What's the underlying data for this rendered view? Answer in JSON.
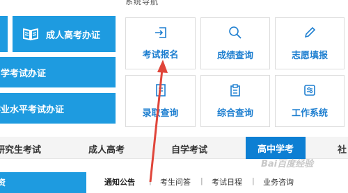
{
  "section_title": "系统导航",
  "left_cards": [
    {
      "label": "成人高考办证",
      "icon": "book-icon"
    },
    {
      "label": "自学考试办证",
      "icon": ""
    },
    {
      "label": "学业水平考试办证",
      "icon": ""
    }
  ],
  "tiles": [
    {
      "label": "考试报名",
      "icon": "login-icon"
    },
    {
      "label": "成绩查询",
      "icon": "search-icon"
    },
    {
      "label": "志愿填报",
      "icon": "pencil-icon"
    },
    {
      "label": "录取查询",
      "icon": "document-icon"
    },
    {
      "label": "综合查询",
      "icon": "clipboard-icon"
    },
    {
      "label": "工作系统",
      "icon": "settings-icon"
    }
  ],
  "nav": {
    "items": [
      "研究生考试",
      "成人高考",
      "自学考试",
      "高中学考",
      "社"
    ],
    "active": "高中学考"
  },
  "sub_tabs": [
    "通知公告",
    "考生问答",
    "考试日程",
    "业务咨询"
  ],
  "left_bottom_text": "资",
  "watermark": "Bai百度经验",
  "colors": {
    "primary": "#1e9be0",
    "active_tab": "#0d7fd3",
    "arrow": "#e0453a",
    "tile_text": "#1e7fd0"
  }
}
